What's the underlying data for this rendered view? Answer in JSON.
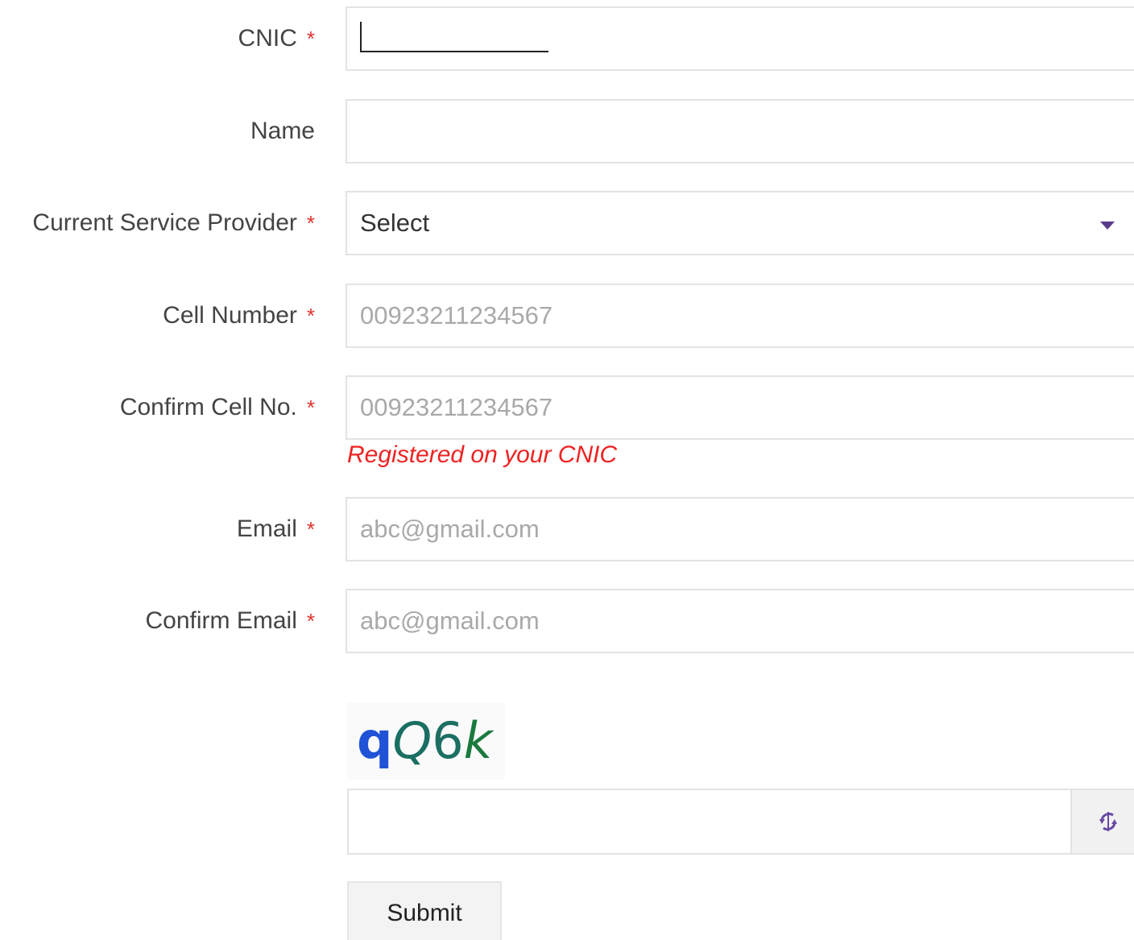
{
  "form": {
    "cnic": {
      "label": "CNIC",
      "required_mark": "*"
    },
    "name": {
      "label": "Name"
    },
    "provider": {
      "label": "Current Service Provider",
      "required_mark": "*",
      "selected": "Select"
    },
    "cell": {
      "label": "Cell Number",
      "required_mark": "*",
      "placeholder": "00923211234567"
    },
    "confirm_cell": {
      "label": "Confirm Cell No.",
      "required_mark": "*",
      "placeholder": "00923211234567",
      "hint": "Registered on your CNIC"
    },
    "email": {
      "label": "Email",
      "required_mark": "*",
      "placeholder": "abc@gmail.com"
    },
    "confirm_email": {
      "label": "Confirm Email",
      "required_mark": "*",
      "placeholder": "abc@gmail.com"
    }
  },
  "captcha": {
    "chars": [
      "q",
      "Q",
      "6",
      "k"
    ],
    "refresh_icon": "refresh-icon"
  },
  "submit": {
    "label": "Submit"
  },
  "colors": {
    "required": "#e0332f",
    "hint": "#ee2222",
    "accent": "#5b3b8a"
  }
}
